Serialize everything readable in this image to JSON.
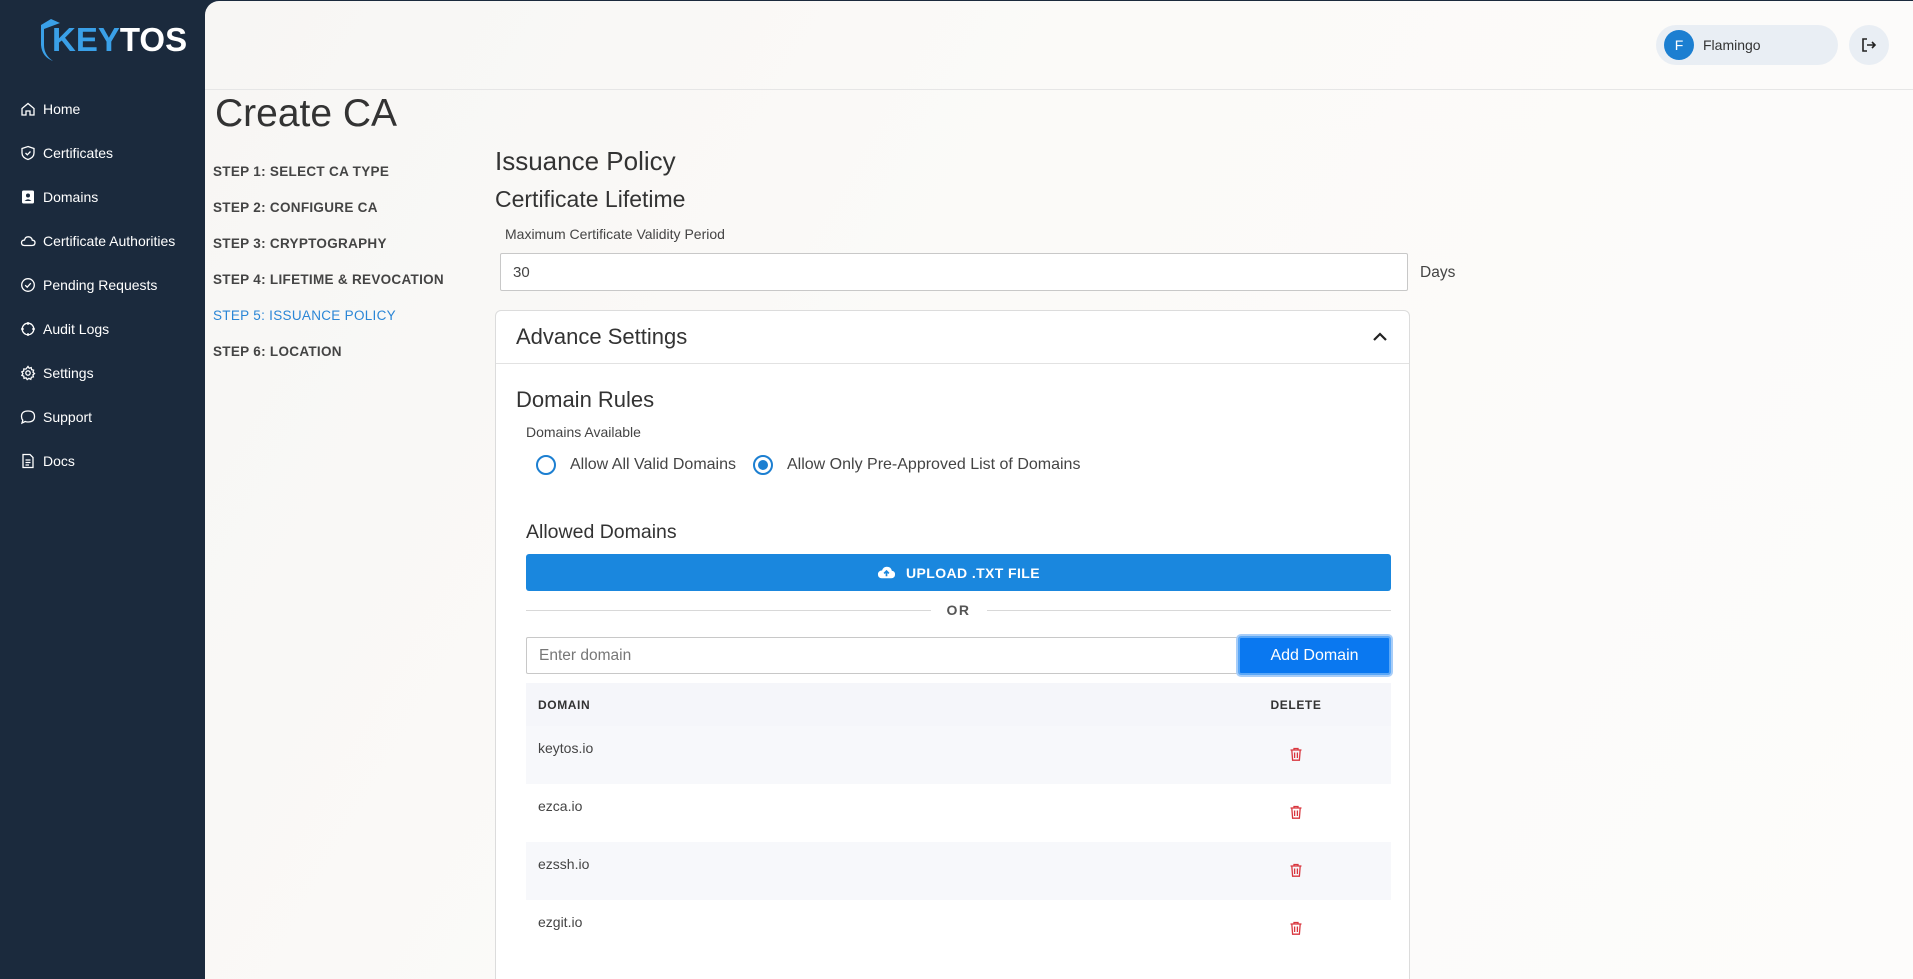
{
  "brand": {
    "key": "KEY",
    "tos": "TOS"
  },
  "nav": [
    {
      "label": "Home",
      "icon": "home-icon"
    },
    {
      "label": "Certificates",
      "icon": "shield-check-icon"
    },
    {
      "label": "Domains",
      "icon": "contact-card-icon"
    },
    {
      "label": "Certificate Authorities",
      "icon": "cloud-icon"
    },
    {
      "label": "Pending Requests",
      "icon": "check-circle-icon"
    },
    {
      "label": "Audit Logs",
      "icon": "crosshair-icon"
    },
    {
      "label": "Settings",
      "icon": "gear-icon"
    },
    {
      "label": "Support",
      "icon": "chat-bubble-icon"
    },
    {
      "label": "Docs",
      "icon": "document-icon"
    }
  ],
  "user": {
    "initial": "F",
    "name": "Flamingo"
  },
  "page": {
    "title": "Create CA"
  },
  "steps": [
    {
      "label": "STEP 1: SELECT CA TYPE",
      "active": false
    },
    {
      "label": "STEP 2: CONFIGURE CA",
      "active": false
    },
    {
      "label": "STEP 3: CRYPTOGRAPHY",
      "active": false
    },
    {
      "label": "STEP 4: LIFETIME & REVOCATION",
      "active": false
    },
    {
      "label": "STEP 5: ISSUANCE POLICY",
      "active": true
    },
    {
      "label": "STEP 6: LOCATION",
      "active": false
    }
  ],
  "issuance": {
    "title": "Issuance Policy",
    "lifetime_title": "Certificate Lifetime",
    "validity_label": "Maximum Certificate Validity Period",
    "validity_value": "30",
    "days_label": "Days"
  },
  "advanced": {
    "title": "Advance Settings",
    "domain_rules_title": "Domain Rules",
    "domains_available_label": "Domains Available",
    "radio_all": "Allow All Valid Domains",
    "radio_preapproved": "Allow Only Pre-Approved List of Domains",
    "selected": "preapproved",
    "allowed_title": "Allowed Domains",
    "upload_label": "UPLOAD .TXT FILE",
    "or_label": "OR",
    "domain_placeholder": "Enter domain",
    "add_label": "Add Domain"
  },
  "table": {
    "col_domain": "DOMAIN",
    "col_delete": "DELETE",
    "rows": [
      "keytos.io",
      "ezca.io",
      "ezssh.io",
      "ezgit.io"
    ]
  },
  "colors": {
    "sidebar": "#1b2a3d",
    "accent": "#1a87de",
    "active_step": "#2a86d6",
    "delete": "#d9363e"
  }
}
